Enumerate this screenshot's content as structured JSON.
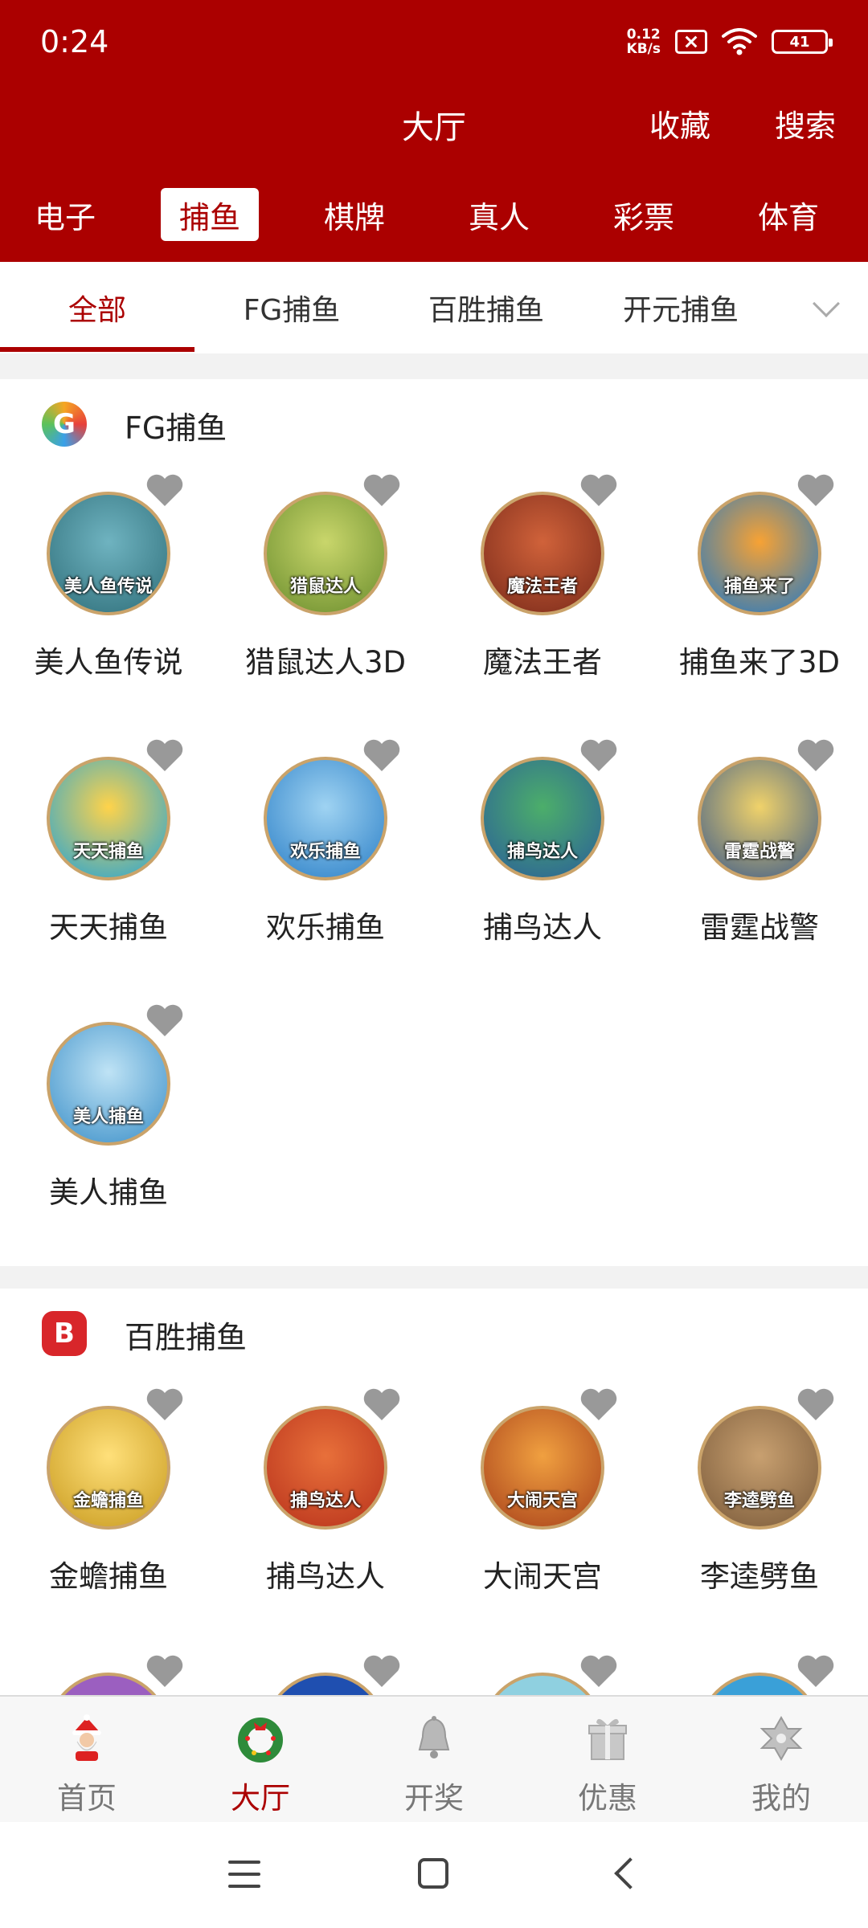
{
  "status_bar": {
    "time": "0:24",
    "net_speed_value": "0.12",
    "net_speed_unit": "KB/s",
    "battery": "41"
  },
  "header": {
    "title": "大厅",
    "favorites": "收藏",
    "search": "搜索"
  },
  "categories": [
    "电子",
    "捕鱼",
    "棋牌",
    "真人",
    "彩票",
    "体育"
  ],
  "active_category": "捕鱼",
  "subtabs": [
    "全部",
    "FG捕鱼",
    "百胜捕鱼",
    "开元捕鱼"
  ],
  "active_subtab": "全部",
  "sections": [
    {
      "title": "FG捕鱼",
      "logo_letter": "G",
      "games": [
        {
          "name": "美人鱼传说",
          "icon_text": "美人鱼传说",
          "color": "#2f6f7a"
        },
        {
          "name": "猎鼠达人3D",
          "icon_text": "猎鼠达人",
          "color": "#6a8d2d"
        },
        {
          "name": "魔法王者",
          "icon_text": "魔法王者",
          "color": "#7a2a1a"
        },
        {
          "name": "捕鱼来了3D",
          "icon_text": "捕鱼来了",
          "color": "#1e78c8"
        },
        {
          "name": "天天捕鱼",
          "icon_text": "天天捕鱼",
          "color": "#1fa3d9"
        },
        {
          "name": "欢乐捕鱼",
          "icon_text": "欢乐捕鱼",
          "color": "#2b7fc7"
        },
        {
          "name": "捕鸟达人",
          "icon_text": "捕鸟达人",
          "color": "#2a5e9a"
        },
        {
          "name": "雷霆战警",
          "icon_text": "雷霆战警",
          "color": "#3b5a8a"
        },
        {
          "name": "美人捕鱼",
          "icon_text": "美人捕鱼",
          "color": "#3b8fc8"
        }
      ]
    },
    {
      "title": "百胜捕鱼",
      "logo_letter": "B",
      "games": [
        {
          "name": "金蟾捕鱼",
          "icon_text": "金蟾捕鱼",
          "color": "#c89a1e"
        },
        {
          "name": "捕鸟达人",
          "icon_text": "捕鸟达人",
          "color": "#b8321c"
        },
        {
          "name": "大闹天宫",
          "icon_text": "大闹天宫",
          "color": "#a8401a"
        },
        {
          "name": "李逵劈鱼",
          "icon_text": "李逵劈鱼",
          "color": "#7a5a3a"
        }
      ]
    }
  ],
  "bottom_nav": [
    {
      "label": "首页",
      "icon": "santa-icon"
    },
    {
      "label": "大厅",
      "icon": "wreath-icon"
    },
    {
      "label": "开奖",
      "icon": "bell-icon"
    },
    {
      "label": "优惠",
      "icon": "gift-icon"
    },
    {
      "label": "我的",
      "icon": "snowflake-icon"
    }
  ],
  "active_nav": "大厅",
  "colors": {
    "brand_red": "#ab0000",
    "heart_gray": "#999999",
    "separator": "#f2f2f2"
  }
}
